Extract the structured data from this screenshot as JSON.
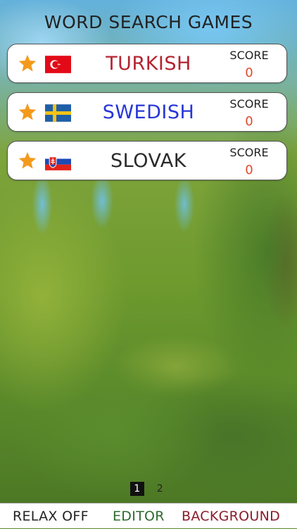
{
  "title": "WORD SEARCH GAMES",
  "colors": {
    "star": "#f39a1c",
    "score_value": "#e04a2e",
    "relax": "#222222",
    "editor": "#2e6b2e",
    "background_button": "#8b1c2a"
  },
  "languages": [
    {
      "name": "TURKISH",
      "flag_icon": "turkey-flag-icon",
      "name_color": "#b32431",
      "score_label": "SCORE",
      "score_value": "0"
    },
    {
      "name": "SWEDISH",
      "flag_icon": "sweden-flag-icon",
      "name_color": "#2636d6",
      "score_label": "SCORE",
      "score_value": "0"
    },
    {
      "name": "SLOVAK",
      "flag_icon": "slovakia-flag-icon",
      "name_color": "#2a2a2a",
      "score_label": "SCORE",
      "score_value": "0"
    }
  ],
  "pager": {
    "pages": [
      "1",
      "2"
    ],
    "active": "1"
  },
  "bottom_bar": {
    "relax_label": "RELAX OFF",
    "editor_label": "EDITOR",
    "background_label": "BACKGROUND"
  }
}
